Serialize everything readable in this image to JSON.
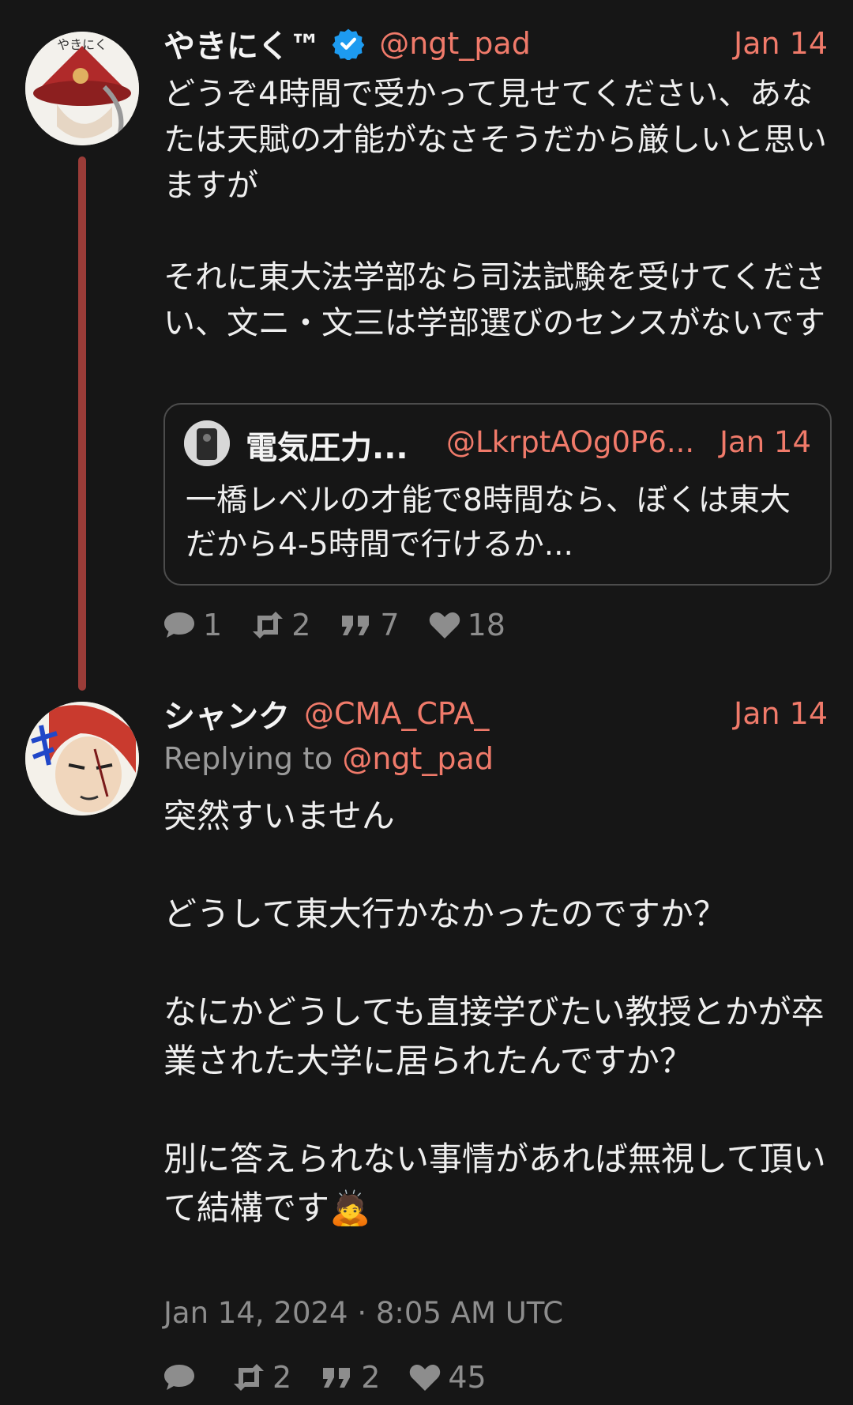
{
  "tweet1": {
    "display_name": "やきにく™",
    "handle": "@ngt_pad",
    "date": "Jan 14",
    "avatar_text": "やきにく",
    "body": "どうぞ4時間で受かって見せてください、あなたは天賦の才能がなさそうだから厳しいと思いますが\n\nそれに東大法学部なら司法試験を受けてください、文ニ・文三は学部選びのセンスがないです",
    "quote": {
      "display_name": "電気圧力...",
      "handle": "@LkrptAOg0P6...",
      "date": "Jan 14",
      "text": "一橋レベルの才能で8時間なら、ぼくは東大だから4-5時間で行けるか..."
    },
    "stats": {
      "replies": "1",
      "retweets": "2",
      "quotes": "7",
      "likes": "18"
    }
  },
  "tweet2": {
    "display_name": "シャンク",
    "handle": "@CMA_CPA_",
    "date": "Jan 14",
    "replying_prefix": "Replying to ",
    "replying_to": "@ngt_pad",
    "body": "突然すいません\n\nどうして東大行かなかったのですか？\n\nなにかどうしても直接学びたい教授とかが卒業された大学に居られたんですか？\n\n別に答えられない事情があれば無視して頂いて結構です🙇",
    "timestamp": "Jan 14, 2024 · 8:05 AM UTC",
    "stats": {
      "retweets": "2",
      "quotes": "2",
      "likes": "45"
    }
  },
  "colors": {
    "accent": "#f07a6a",
    "thread_line": "#9a3c38",
    "background": "#161616",
    "verified": "#1d9bf0"
  }
}
